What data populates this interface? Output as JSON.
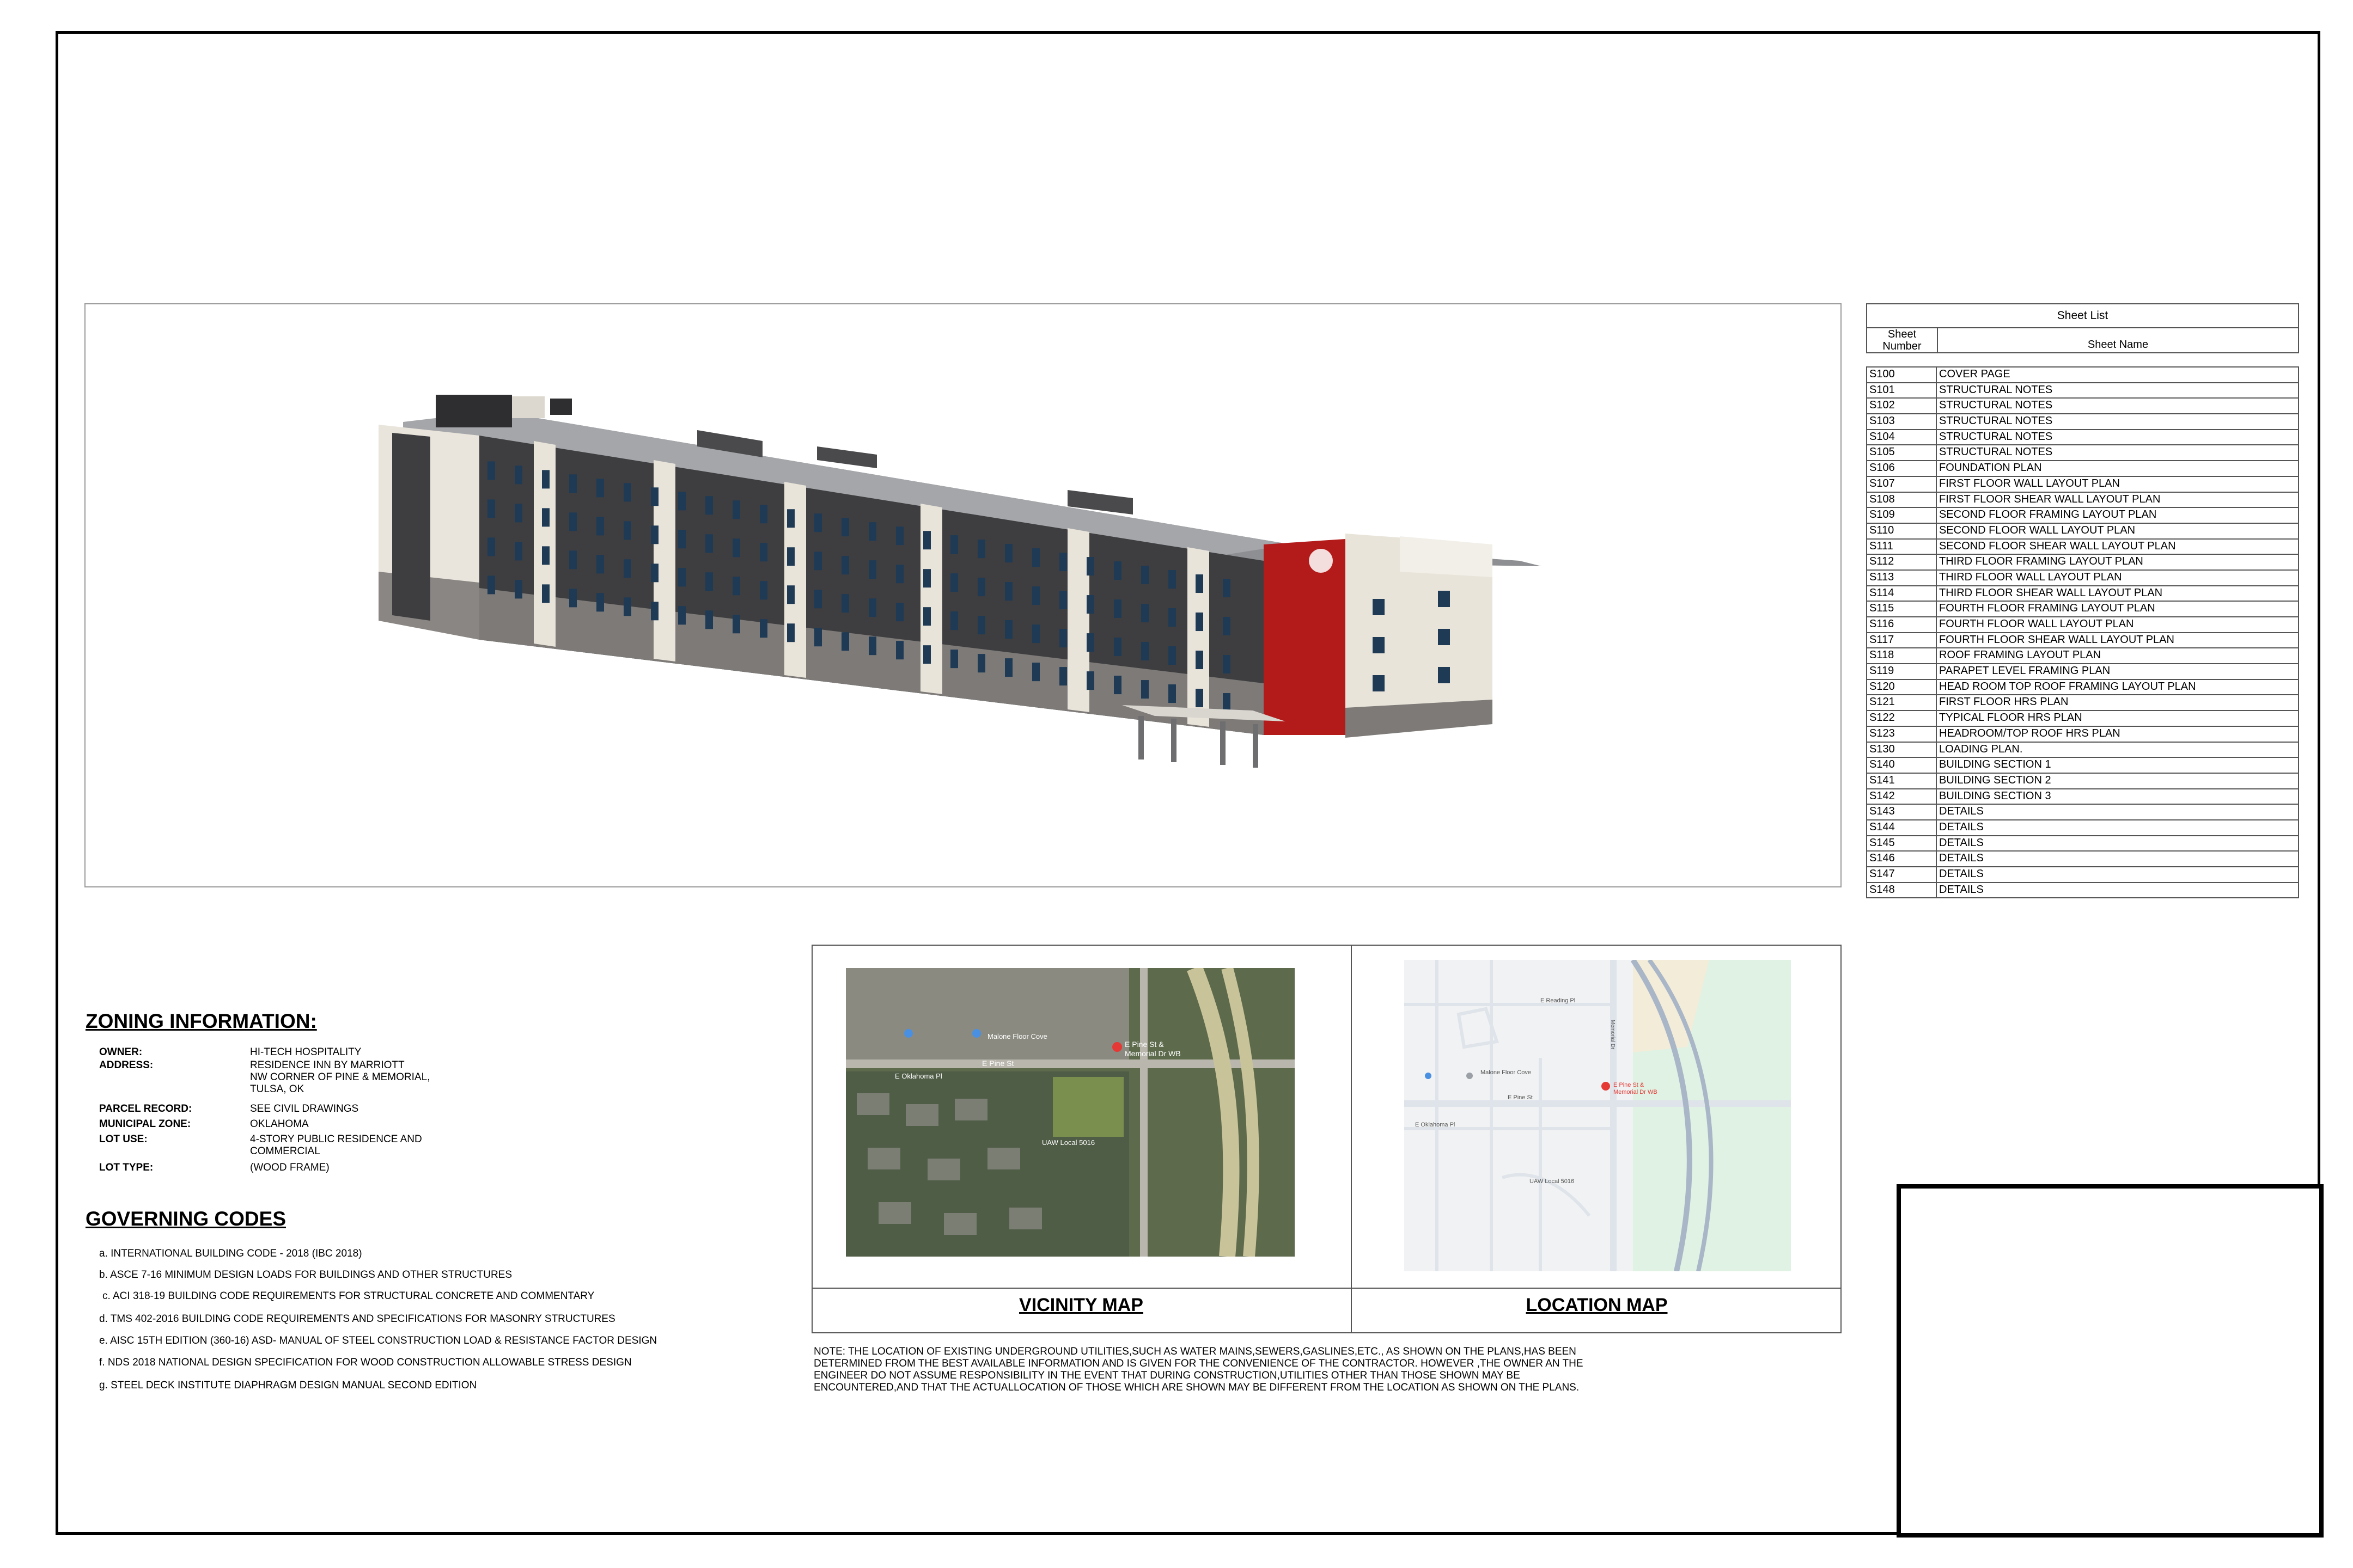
{
  "sheet_list": {
    "title": "Sheet List",
    "col_number": "Sheet Number",
    "col_name": "Sheet Name",
    "rows": [
      {
        "num": "S100",
        "name": "COVER PAGE"
      },
      {
        "num": "S101",
        "name": "STRUCTURAL NOTES"
      },
      {
        "num": "S102",
        "name": "STRUCTURAL NOTES"
      },
      {
        "num": "S103",
        "name": "STRUCTURAL NOTES"
      },
      {
        "num": "S104",
        "name": "STRUCTURAL NOTES"
      },
      {
        "num": "S105",
        "name": "STRUCTURAL NOTES"
      },
      {
        "num": "S106",
        "name": "FOUNDATION PLAN"
      },
      {
        "num": "S107",
        "name": "FIRST FLOOR WALL LAYOUT PLAN"
      },
      {
        "num": "S108",
        "name": "FIRST FLOOR SHEAR WALL LAYOUT PLAN"
      },
      {
        "num": "S109",
        "name": "SECOND FLOOR FRAMING LAYOUT PLAN"
      },
      {
        "num": "S110",
        "name": "SECOND FLOOR WALL  LAYOUT PLAN"
      },
      {
        "num": "S111",
        "name": "SECOND FLOOR SHEAR WALL  LAYOUT PLAN"
      },
      {
        "num": "S112",
        "name": "THIRD  FLOOR FRAMING  LAYOUT PLAN"
      },
      {
        "num": "S113",
        "name": "THIRD  FLOOR WALL  LAYOUT PLAN"
      },
      {
        "num": "S114",
        "name": "THIRD FLOOR SHEAR  WALL LAYOUT PLAN"
      },
      {
        "num": "S115",
        "name": "FOURTH  FLOOR FRAMING LAYOUT PLAN"
      },
      {
        "num": "S116",
        "name": "FOURTH  FLOOR WALL LAYOUT PLAN"
      },
      {
        "num": "S117",
        "name": "FOURTH  FLOOR SHEAR WALL LAYOUT PLAN"
      },
      {
        "num": "S118",
        "name": "ROOF FRAMING LAYOUT PLAN"
      },
      {
        "num": "S119",
        "name": "PARAPET LEVEL FRAMING PLAN"
      },
      {
        "num": "S120",
        "name": "HEAD ROOM TOP ROOF FRAMING LAYOUT PLAN"
      },
      {
        "num": "S121",
        "name": "FIRST FLOOR HRS PLAN"
      },
      {
        "num": "S122",
        "name": "TYPICAL FLOOR HRS PLAN"
      },
      {
        "num": "S123",
        "name": "HEADROOM/TOP ROOF HRS PLAN"
      },
      {
        "num": "S130",
        "name": "LOADING PLAN."
      },
      {
        "num": "S140",
        "name": "BUILDING SECTION 1"
      },
      {
        "num": "S141",
        "name": "BUILDING SECTION 2"
      },
      {
        "num": "S142",
        "name": "BUILDING SECTION 3"
      },
      {
        "num": "S143",
        "name": "DETAILS"
      },
      {
        "num": "S144",
        "name": "DETAILS"
      },
      {
        "num": "S145",
        "name": "DETAILS"
      },
      {
        "num": "S146",
        "name": "DETAILS"
      },
      {
        "num": "S147",
        "name": "DETAILS"
      },
      {
        "num": "S148",
        "name": "DETAILS"
      }
    ]
  },
  "zoning": {
    "heading": "ZONING INFORMATION:",
    "owner_label": "OWNER:",
    "owner": "HI-TECH HOSPITALITY",
    "address_label": "ADDRESS:",
    "address": "RESIDENCE INN BY MARRIOTT\nNW CORNER OF PINE & MEMORIAL,\nTULSA, OK",
    "parcel_label": "PARCEL RECORD:",
    "parcel": "SEE CIVIL DRAWINGS",
    "zone_label": "MUNICIPAL ZONE:",
    "zone": "OKLAHOMA",
    "lotuse_label": "LOT USE:",
    "lotuse": "4-STORY PUBLIC RESIDENCE AND\nCOMMERCIAL",
    "lottype_label": "LOT TYPE:",
    "lottype": "(WOOD FRAME)"
  },
  "governing": {
    "heading": "GOVERNING CODES",
    "codes": [
      "a. INTERNATIONAL BUILDING CODE - 2018 (IBC 2018)",
      "b. ASCE 7-16 MINIMUM DESIGN LOADS FOR BUILDINGS AND OTHER STRUCTURES",
      "c. ACI 318-19 BUILDING CODE REQUIREMENTS FOR STRUCTURAL CONCRETE AND COMMENTARY",
      "d. TMS 402-2016 BUILDING CODE REQUIREMENTS AND SPECIFICATIONS FOR MASONRY STRUCTURES",
      "e. AISC 15TH EDITION (360-16) ASD- MANUAL OF STEEL CONSTRUCTION LOAD & RESISTANCE FACTOR DESIGN",
      "f.  NDS 2018 NATIONAL DESIGN SPECIFICATION FOR WOOD CONSTRUCTION ALLOWABLE STRESS DESIGN",
      "g. STEEL DECK INSTITUTE DIAPHRAGM DESIGN MANUAL SECOND EDITION"
    ]
  },
  "maps": {
    "vicinity_title": "VICINITY MAP",
    "location_title": "LOCATION MAP",
    "pin_label_1": "E Pine St &",
    "pin_label_2": "Memorial Dr WB",
    "street_pine": "E Pine St",
    "street_oklahoma": "E Oklahoma Pl",
    "street_reading": "E Reading Pl",
    "street_memorial": "Memorial Dr",
    "place_1": "Malone Floor Cove",
    "place_2": "UAW Local 5016"
  },
  "note": "NOTE: THE LOCATION OF EXISTING UNDERGROUND UTILITIES,SUCH AS WATER MAINS,SEWERS,GASLINES,ETC., AS SHOWN ON THE PLANS,HAS BEEN DETERMINED FROM THE BEST AVAILABLE INFORMATION AND IS GIVEN FOR THE CONVENIENCE OF THE CONTRACTOR. HOWEVER ,THE OWNER AN THE ENGINEER DO NOT ASSUME RESPONSIBILITY IN THE EVENT THAT DURING CONSTRUCTION,UTILITIES OTHER THAN THOSE SHOWN MAY BE ENCOUNTERED,AND THAT THE ACTUALLOCATION OF THOSE WHICH ARE SHOWN MAY BE DIFFERENT FROM THE LOCATION AS SHOWN ON THE PLANS.",
  "colors": {
    "facade_dark": "#3e3e40",
    "facade_light": "#e9e4da",
    "brand_red": "#b31b1b",
    "masonry": "#7d7a78"
  }
}
